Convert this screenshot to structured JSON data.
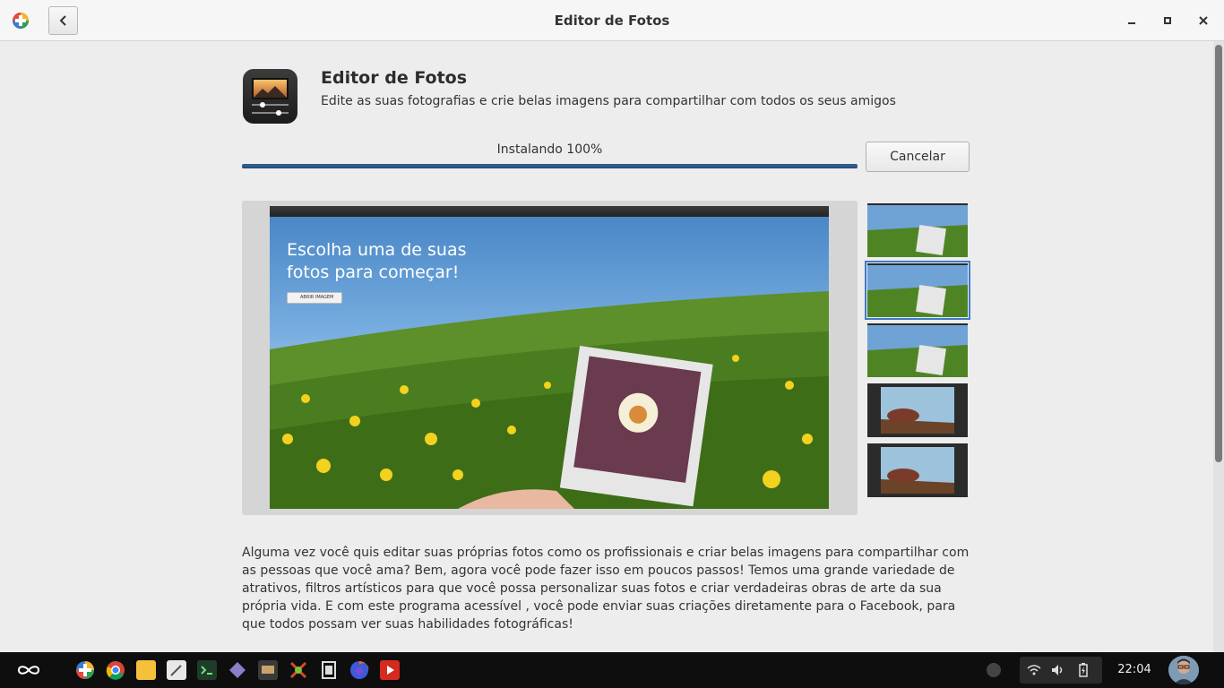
{
  "window": {
    "title": "Editor de Fotos",
    "back_icon": "chevron-left-icon",
    "controls": [
      "minimize-icon",
      "maximize-icon",
      "close-icon"
    ]
  },
  "app": {
    "name": "Editor de Fotos",
    "summary": "Edite as suas fotografias e crie belas imagens para compartilhar com todos os seus amigos",
    "icon": "photo-editor-icon"
  },
  "install": {
    "status_label": "Instalando 100%",
    "progress": 1.0,
    "cancel_label": "Cancelar"
  },
  "screenshot": {
    "headline": "Escolha uma de suas fotos para começar!",
    "open_button_label": "ABRIR IMAGEM",
    "thumbnails_count": 5,
    "selected_thumbnail": 2
  },
  "description": "Alguma vez você quis editar suas próprias fotos como os profissionais e criar belas imagens para compartilhar com as pessoas que você ama? Bem, agora você pode fazer isso em poucos passos! Temos uma grande variedade de atrativos, filtros artísticos para que você possa personalizar suas fotos e criar verdadeiras obras de arte da sua própria vida. E com este programa acessível , você pode enviar suas criações diretamente para o Facebook, para que todos possam ver suas habilidades fotográficas!",
  "taskbar": {
    "apps": [
      "app-center-icon",
      "chrome-icon",
      "files-icon",
      "text-editor-icon",
      "terminal-icon",
      "crystal-app-icon",
      "photo-app-icon",
      "game-icon",
      "film-icon",
      "firefox-icon",
      "youtube-icon"
    ],
    "tray": [
      "wifi-icon",
      "volume-icon",
      "battery-icon"
    ],
    "clock": "22:04"
  },
  "colors": {
    "progress": "#2c5b8e",
    "accent": "#3d7bc8"
  }
}
